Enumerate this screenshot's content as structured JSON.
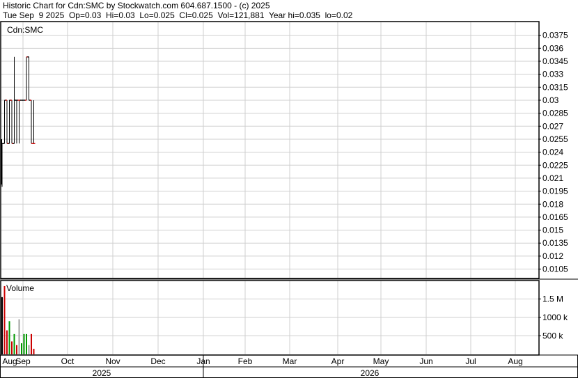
{
  "header": {
    "line1": "Historic Chart for Cdn:SMC by Stockwatch.com 604.687.1500 - (c) 2025",
    "line2": "Tue Sep  9 2025  Op=0.03  Hi=0.03  Lo=0.025  Cl=0.025  Vol=121,881  Year hi=0.035  lo=0.02"
  },
  "chart_data": [
    {
      "type": "ohlc",
      "title": "Cdn:SMC",
      "y_ticks": [
        "0.0375",
        "0.036",
        "0.0345",
        "0.033",
        "0.0315",
        "0.03",
        "0.0285",
        "0.027",
        "0.0255",
        "0.024",
        "0.0225",
        "0.021",
        "0.0195",
        "0.018",
        "0.0165",
        "0.015",
        "0.0135",
        "0.012",
        "0.0105"
      ],
      "ylim": [
        0.0095,
        0.039
      ],
      "grid": true,
      "x_months": [
        "Aug",
        "Sep",
        "Oct",
        "Nov",
        "Dec",
        "Jan",
        "Feb",
        "Mar",
        "Apr",
        "May",
        "Jun",
        "Jul",
        "Aug"
      ],
      "years": [
        "2025",
        "2026"
      ],
      "bars": [
        {
          "i": 0,
          "open": 0.025,
          "high": 0.025,
          "low": 0.02,
          "close": 0.025,
          "color": "#000000"
        },
        {
          "i": 1,
          "open": 0.025,
          "high": 0.03,
          "low": 0.025,
          "close": 0.03,
          "color": "#000000"
        },
        {
          "i": 2,
          "open": 0.03,
          "high": 0.03,
          "low": 0.025,
          "close": 0.025,
          "color": "#cc0000"
        },
        {
          "i": 3,
          "open": 0.025,
          "high": 0.03,
          "low": 0.025,
          "close": 0.03,
          "color": "#000000"
        },
        {
          "i": 4,
          "open": 0.03,
          "high": 0.03,
          "low": 0.025,
          "close": 0.025,
          "color": "#cc0000"
        },
        {
          "i": 5,
          "open": 0.025,
          "high": 0.035,
          "low": 0.025,
          "close": 0.03,
          "color": "#000000"
        },
        {
          "i": 6,
          "open": 0.03,
          "high": 0.03,
          "low": 0.025,
          "close": 0.03,
          "color": "#000000"
        },
        {
          "i": 7,
          "open": 0.03,
          "high": 0.03,
          "low": 0.025,
          "close": 0.03,
          "color": "#cc0000"
        },
        {
          "i": 8,
          "open": 0.03,
          "high": 0.03,
          "low": 0.03,
          "close": 0.03,
          "color": "#000000"
        },
        {
          "i": 9,
          "open": 0.03,
          "high": 0.03,
          "low": 0.03,
          "close": 0.03,
          "color": "#000000"
        },
        {
          "i": 10,
          "open": 0.03,
          "high": 0.035,
          "low": 0.03,
          "close": 0.035,
          "color": "#cc0000"
        },
        {
          "i": 11,
          "open": 0.035,
          "high": 0.035,
          "low": 0.03,
          "close": 0.03,
          "color": "#000000"
        },
        {
          "i": 12,
          "open": 0.03,
          "high": 0.03,
          "low": 0.025,
          "close": 0.025,
          "color": "#cc0000"
        },
        {
          "i": 13,
          "open": 0.025,
          "high": 0.03,
          "low": 0.025,
          "close": 0.025,
          "color": "#cc0000"
        }
      ]
    },
    {
      "type": "bar",
      "title": "Volume",
      "y_ticks": [
        "1.5 M",
        "1000 k",
        "500 k"
      ],
      "y_tick_values": [
        1500000,
        1000000,
        500000
      ],
      "ylim": [
        0,
        2000000
      ],
      "volumes": [
        {
          "i": 0,
          "value": 1550000,
          "color": "#000000"
        },
        {
          "i": 1,
          "value": 1850000,
          "color": "#cc0000"
        },
        {
          "i": 2,
          "value": 650000,
          "color": "#cc0000"
        },
        {
          "i": 3,
          "value": 900000,
          "color": "#009900"
        },
        {
          "i": 4,
          "value": 350000,
          "color": "#cc0000"
        },
        {
          "i": 5,
          "value": 550000,
          "color": "#009900"
        },
        {
          "i": 6,
          "value": 250000,
          "color": "#cc0000"
        },
        {
          "i": 7,
          "value": 950000,
          "color": "#a0a0a0"
        },
        {
          "i": 8,
          "value": 300000,
          "color": "#009900"
        },
        {
          "i": 9,
          "value": 550000,
          "color": "#009900"
        },
        {
          "i": 10,
          "value": 550000,
          "color": "#009900"
        },
        {
          "i": 11,
          "value": 250000,
          "color": "#a0a0a0"
        },
        {
          "i": 12,
          "value": 550000,
          "color": "#cc0000"
        },
        {
          "i": 13,
          "value": 150000,
          "color": "#cc0000"
        }
      ]
    }
  ]
}
